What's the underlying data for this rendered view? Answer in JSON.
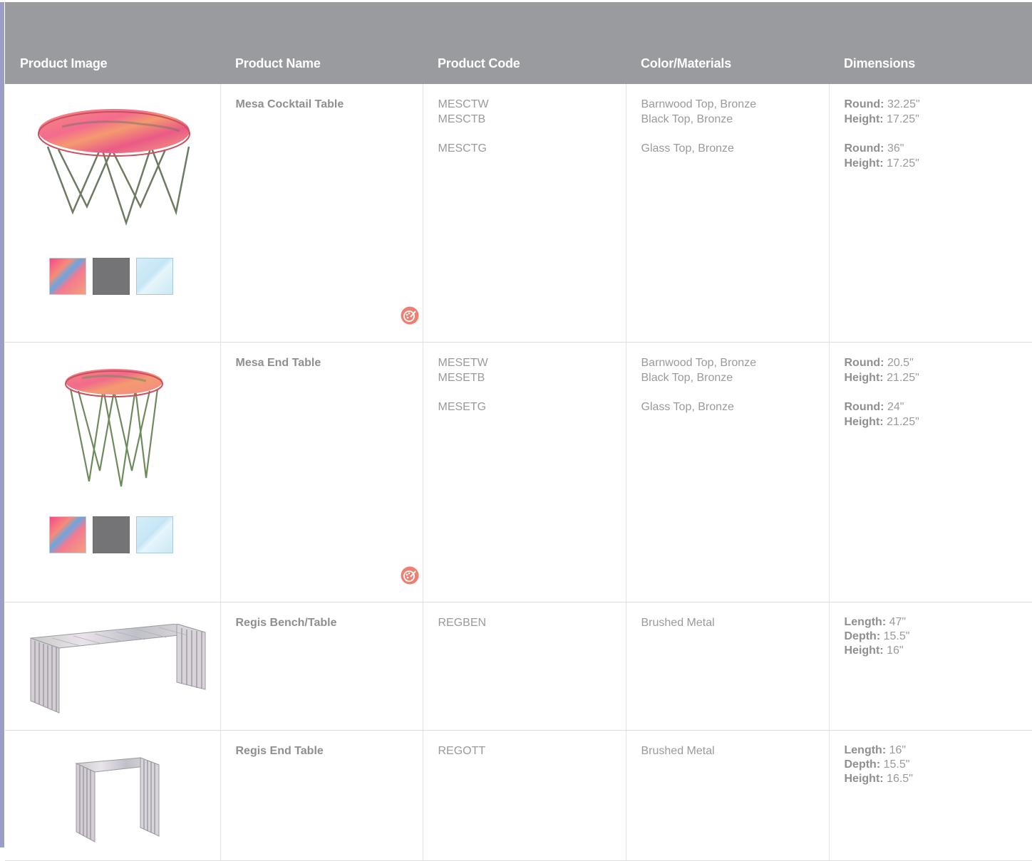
{
  "header": {
    "col_image": "Product Image",
    "col_name": "Product Name",
    "col_code": "Product Code",
    "col_color": "Color/Materials",
    "col_dims": "Dimensions"
  },
  "colors": {
    "header_bg": "#9a9b9e",
    "accent": "#ef7f72",
    "swatch_black": "#747477"
  },
  "rows": [
    {
      "name": "Mesa Cocktail Table",
      "image_icon": "round-cocktail-table",
      "swatches": [
        "barnwood",
        "black",
        "glass"
      ],
      "codes": [
        "MESCTW",
        "MESCTB",
        "MESCTG"
      ],
      "colors": [
        "Barnwood Top, Bronze",
        "Black Top, Bronze",
        "Glass Top, Bronze"
      ],
      "dims": [
        {
          "label": "Round:",
          "value": "32.25\""
        },
        {
          "label": "Height:",
          "value": "17.25\""
        },
        {
          "label": "Round:",
          "value": "36\""
        },
        {
          "label": "Height:",
          "value": "17.25\""
        }
      ]
    },
    {
      "name": "Mesa End Table",
      "image_icon": "round-end-table",
      "swatches": [
        "barnwood",
        "black",
        "glass"
      ],
      "codes": [
        "MESETW",
        "MESETB",
        "MESETG"
      ],
      "colors": [
        "Barnwood Top, Bronze",
        "Black Top, Bronze",
        "Glass Top, Bronze"
      ],
      "dims": [
        {
          "label": "Round:",
          "value": "20.5\""
        },
        {
          "label": "Height:",
          "value": "21.25\""
        },
        {
          "label": "Round:",
          "value": "24\""
        },
        {
          "label": "Height:",
          "value": "21.25\""
        }
      ]
    },
    {
      "name": "Regis Bench/Table",
      "image_icon": "slatted-bench",
      "codes": [
        "REGBEN"
      ],
      "colors": [
        "Brushed Metal"
      ],
      "dims": [
        {
          "label": "Length:",
          "value": "47\""
        },
        {
          "label": "Depth:",
          "value": "15.5\""
        },
        {
          "label": "Height:",
          "value": "16\""
        }
      ]
    },
    {
      "name": "Regis End Table",
      "image_icon": "slatted-end-table",
      "codes": [
        "REGOTT"
      ],
      "colors": [
        "Brushed Metal"
      ],
      "dims": [
        {
          "label": "Length:",
          "value": "16\""
        },
        {
          "label": "Depth:",
          "value": "15.5\""
        },
        {
          "label": "Height:",
          "value": "16.5\""
        }
      ]
    }
  ]
}
